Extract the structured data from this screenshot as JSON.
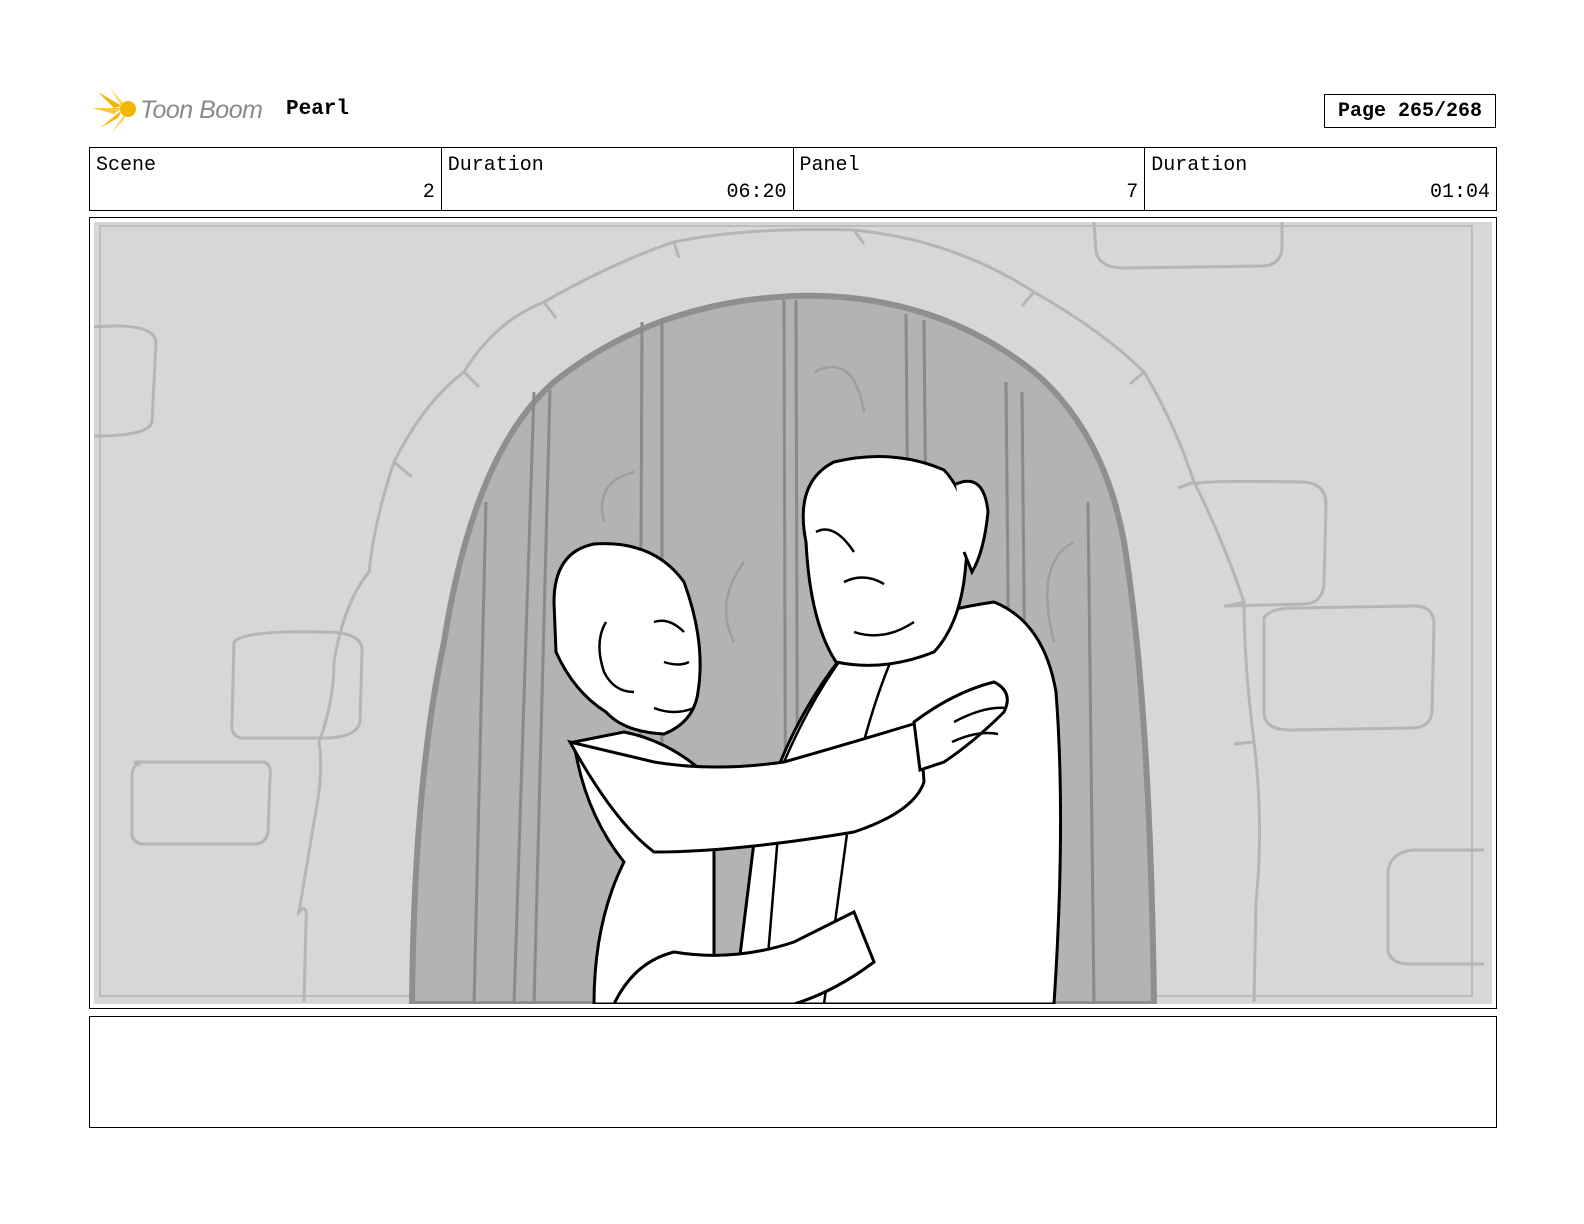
{
  "header": {
    "brand": "Toon Boom",
    "project_title": "Pearl",
    "page": "Page 265/268"
  },
  "info": {
    "scene_label": "Scene",
    "scene_value": "2",
    "scene_duration_label": "Duration",
    "scene_duration_value": "06:20",
    "panel_label": "Panel",
    "panel_value": "7",
    "panel_duration_label": "Duration",
    "panel_duration_value": "01:04"
  },
  "notes": {
    "text": ""
  },
  "colors": {
    "logo_accent": "#f2b705",
    "wall": "#d7d7d7",
    "door": "#b3b3b3",
    "line": "#000000"
  }
}
